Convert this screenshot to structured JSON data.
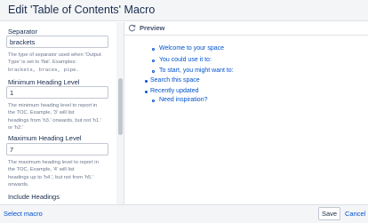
{
  "dialog": {
    "title": "Edit 'Table of Contents' Macro"
  },
  "fields": {
    "separator": {
      "label": "Separator",
      "value": "brackets",
      "help_line1": "The type of separator used when 'Output",
      "help_line2": "Type' is set to 'flat'. Examples:",
      "help_codes": "brackets, braces, pipe."
    },
    "min_heading": {
      "label": "Minimum Heading Level",
      "value": "1",
      "help_line1": "The minimum heading level to report in",
      "help_line2": "the TOC. Example, '3' will list",
      "help_line3": "headings from 'h3.' onwards, but not 'h1.'",
      "help_line4": "or 'h2.'"
    },
    "max_heading": {
      "label": "Maximum Heading Level",
      "value": "7",
      "help_line1": "The maximum heading level to report in",
      "help_line2": "the TOC. Example, '4' will list",
      "help_line3": "headings up to 'h4.', but not from 'h5.'",
      "help_line4": "onwards."
    },
    "include_headings": {
      "label": "Include Headings"
    }
  },
  "preview": {
    "label": "Preview",
    "items": [
      "Welcome to your space",
      "You could use it to:",
      "To start, you might want to:",
      "Search this space",
      "Recently updated",
      "Need inspiration?"
    ]
  },
  "footer": {
    "select_macro": "Select macro",
    "save": "Save",
    "cancel": "Cancel"
  },
  "icons": {
    "refresh": "refresh-icon"
  },
  "colors": {
    "link": "#0052cc",
    "text": "#172b4d",
    "muted": "#6b778c",
    "header_bg": "#f4f5f7"
  }
}
